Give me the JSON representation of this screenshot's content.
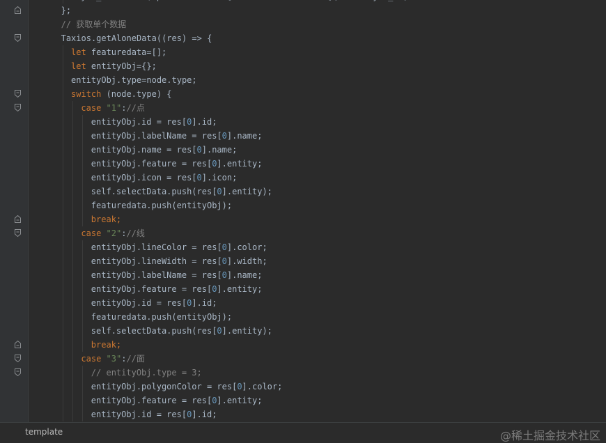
{
  "colors": {
    "background": "#2b2b2b",
    "gutter": "#313335",
    "default_text": "#a9b7c6",
    "keyword": "#cc7832",
    "string": "#6a8759",
    "comment": "#808080",
    "number": "#6897bb"
  },
  "editor": {
    "lines": [
      {
        "indent": 10,
        "fold": "none",
        "tokens": [
          {
            "t": "layer_id: self.$options.filters[",
            "c": "n"
          },
          {
            "t": "\"dataNullFromTable\"",
            "c": "s"
          },
          {
            "t": "](node.layer_id)",
            "c": "n"
          }
        ]
      },
      {
        "indent": 8,
        "fold": "end",
        "tokens": [
          {
            "t": "};",
            "c": "n"
          }
        ]
      },
      {
        "indent": 8,
        "fold": "none",
        "tokens": [
          {
            "t": "// 获取单个数据",
            "c": "c"
          }
        ]
      },
      {
        "indent": 8,
        "fold": "start",
        "tokens": [
          {
            "t": "Taxios.getAloneData((res) => {",
            "c": "n"
          }
        ]
      },
      {
        "indent": 10,
        "fold": "none",
        "tokens": [
          {
            "t": "let ",
            "c": "k"
          },
          {
            "t": "featuredata=[];",
            "c": "n"
          }
        ]
      },
      {
        "indent": 10,
        "fold": "none",
        "tokens": [
          {
            "t": "let ",
            "c": "k"
          },
          {
            "t": "entityObj={};",
            "c": "n"
          }
        ]
      },
      {
        "indent": 10,
        "fold": "none",
        "tokens": [
          {
            "t": "entityObj.type=node.type;",
            "c": "n"
          }
        ]
      },
      {
        "indent": 10,
        "fold": "start",
        "tokens": [
          {
            "t": "switch ",
            "c": "k"
          },
          {
            "t": "(node.type) {",
            "c": "n"
          }
        ]
      },
      {
        "indent": 12,
        "fold": "start",
        "tokens": [
          {
            "t": "case ",
            "c": "k"
          },
          {
            "t": "\"1\"",
            "c": "s"
          },
          {
            "t": ":",
            "c": "n"
          },
          {
            "t": "//点",
            "c": "c"
          }
        ]
      },
      {
        "indent": 14,
        "fold": "none",
        "tokens": [
          {
            "t": "entityObj.id = res[",
            "c": "n"
          },
          {
            "t": "0",
            "c": "u"
          },
          {
            "t": "].id;",
            "c": "n"
          }
        ]
      },
      {
        "indent": 14,
        "fold": "none",
        "tokens": [
          {
            "t": "entityObj.labelName = res[",
            "c": "n"
          },
          {
            "t": "0",
            "c": "u"
          },
          {
            "t": "].name;",
            "c": "n"
          }
        ]
      },
      {
        "indent": 14,
        "fold": "none",
        "tokens": [
          {
            "t": "entityObj.name = res[",
            "c": "n"
          },
          {
            "t": "0",
            "c": "u"
          },
          {
            "t": "].name;",
            "c": "n"
          }
        ]
      },
      {
        "indent": 14,
        "fold": "none",
        "tokens": [
          {
            "t": "entityObj.feature = res[",
            "c": "n"
          },
          {
            "t": "0",
            "c": "u"
          },
          {
            "t": "].entity;",
            "c": "n"
          }
        ]
      },
      {
        "indent": 14,
        "fold": "none",
        "tokens": [
          {
            "t": "entityObj.icon = res[",
            "c": "n"
          },
          {
            "t": "0",
            "c": "u"
          },
          {
            "t": "].icon;",
            "c": "n"
          }
        ]
      },
      {
        "indent": 14,
        "fold": "none",
        "tokens": [
          {
            "t": "self.selectData.push(res[",
            "c": "n"
          },
          {
            "t": "0",
            "c": "u"
          },
          {
            "t": "].entity);",
            "c": "n"
          }
        ]
      },
      {
        "indent": 14,
        "fold": "none",
        "tokens": [
          {
            "t": "featuredata.push(entityObj);",
            "c": "n"
          }
        ]
      },
      {
        "indent": 14,
        "fold": "end",
        "tokens": [
          {
            "t": "break;",
            "c": "k"
          }
        ]
      },
      {
        "indent": 12,
        "fold": "start",
        "tokens": [
          {
            "t": "case ",
            "c": "k"
          },
          {
            "t": "\"2\"",
            "c": "s"
          },
          {
            "t": ":",
            "c": "n"
          },
          {
            "t": "//线",
            "c": "c"
          }
        ]
      },
      {
        "indent": 14,
        "fold": "none",
        "tokens": [
          {
            "t": "entityObj.lineColor = res[",
            "c": "n"
          },
          {
            "t": "0",
            "c": "u"
          },
          {
            "t": "].color;",
            "c": "n"
          }
        ]
      },
      {
        "indent": 14,
        "fold": "none",
        "tokens": [
          {
            "t": "entityObj.lineWidth = res[",
            "c": "n"
          },
          {
            "t": "0",
            "c": "u"
          },
          {
            "t": "].width;",
            "c": "n"
          }
        ]
      },
      {
        "indent": 14,
        "fold": "none",
        "tokens": [
          {
            "t": "entityObj.labelName = res[",
            "c": "n"
          },
          {
            "t": "0",
            "c": "u"
          },
          {
            "t": "].name;",
            "c": "n"
          }
        ]
      },
      {
        "indent": 14,
        "fold": "none",
        "tokens": [
          {
            "t": "entityObj.feature = res[",
            "c": "n"
          },
          {
            "t": "0",
            "c": "u"
          },
          {
            "t": "].entity;",
            "c": "n"
          }
        ]
      },
      {
        "indent": 14,
        "fold": "none",
        "tokens": [
          {
            "t": "entityObj.id = res[",
            "c": "n"
          },
          {
            "t": "0",
            "c": "u"
          },
          {
            "t": "].id;",
            "c": "n"
          }
        ]
      },
      {
        "indent": 14,
        "fold": "none",
        "tokens": [
          {
            "t": "featuredata.push(entityObj);",
            "c": "n"
          }
        ]
      },
      {
        "indent": 14,
        "fold": "none",
        "tokens": [
          {
            "t": "self.selectData.push(res[",
            "c": "n"
          },
          {
            "t": "0",
            "c": "u"
          },
          {
            "t": "].entity);",
            "c": "n"
          }
        ]
      },
      {
        "indent": 14,
        "fold": "end",
        "tokens": [
          {
            "t": "break;",
            "c": "k"
          }
        ]
      },
      {
        "indent": 12,
        "fold": "start",
        "tokens": [
          {
            "t": "case ",
            "c": "k"
          },
          {
            "t": "\"3\"",
            "c": "s"
          },
          {
            "t": ":",
            "c": "n"
          },
          {
            "t": "//面",
            "c": "c"
          }
        ]
      },
      {
        "indent": 14,
        "fold": "start",
        "tokens": [
          {
            "t": "// entityObj.type = 3;",
            "c": "c"
          }
        ]
      },
      {
        "indent": 14,
        "fold": "none",
        "tokens": [
          {
            "t": "entityObj.polygonColor = res[",
            "c": "n"
          },
          {
            "t": "0",
            "c": "u"
          },
          {
            "t": "].color;",
            "c": "n"
          }
        ]
      },
      {
        "indent": 14,
        "fold": "none",
        "tokens": [
          {
            "t": "entityObj.feature = res[",
            "c": "n"
          },
          {
            "t": "0",
            "c": "u"
          },
          {
            "t": "].entity;",
            "c": "n"
          }
        ]
      },
      {
        "indent": 14,
        "fold": "none",
        "tokens": [
          {
            "t": "entityObj.id = res[",
            "c": "n"
          },
          {
            "t": "0",
            "c": "u"
          },
          {
            "t": "].id;",
            "c": "n"
          }
        ]
      }
    ]
  },
  "status_bar": {
    "breadcrumb": "template",
    "watermark": "@稀土掘金技术社区"
  }
}
